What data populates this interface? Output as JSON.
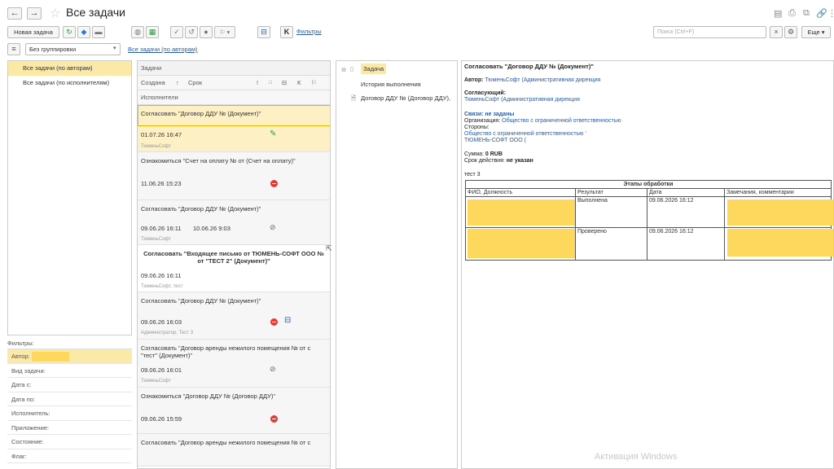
{
  "window": {
    "title": "Все задачи"
  },
  "toolbar": {
    "new_task": "Новая задача",
    "filters_link": "Фильтры",
    "search_placeholder": "Поиск (Ctrl+F)",
    "more": "Еще"
  },
  "grouping": {
    "value": "Без группировки",
    "link": "Все задачи (по авторам)"
  },
  "left_nav": [
    "Все задачи (по авторам)",
    "Все задачи (по исполнителям)"
  ],
  "filters": {
    "label": "Фильтры:",
    "items": [
      "Автор:",
      "Вид задачи:",
      "Дата с:",
      "Дата по:",
      "Исполнитель:",
      "Приложение:",
      "Состояние:",
      "Флаг:"
    ]
  },
  "task_list": {
    "header": "Задачи",
    "col_created": "Создана",
    "col_due": "Срок",
    "col_executors": "Исполнители",
    "col_k": "К",
    "tasks": [
      {
        "title": "Согласовать \"Договор ДДУ № (Документ)\"",
        "date": "01.07.26 16:47",
        "date2": "",
        "sub": "ТюменьСофт"
      },
      {
        "title": "Ознакомиться \"Счет на оплату № от (Счет на оплату)\"",
        "date": "11.06.26 15:23",
        "date2": "",
        "sub": ""
      },
      {
        "title": "Согласовать \"Договор ДДУ № (Документ)\"",
        "date": "09.06.26 16:11",
        "date2": "10.06.26 9:03",
        "sub": "ТюменьСофт"
      },
      {
        "title": "Согласовать \"Входящее письмо от ТЮМЕНЬ-СОФТ ООО № от \"ТЕСТ 2\" (Документ)\"",
        "date": "09.06.26 16:11",
        "date2": "",
        "sub": "ТюменьСофт, тест"
      },
      {
        "title": "Согласовать \"Договор ДДУ № (Документ)\"",
        "date": "09.06.26 16:03",
        "date2": "",
        "sub": "Администратор, Тест 3"
      },
      {
        "title": "Согласовать \"Договор аренды нежилого помещения № от с \"тест\" (Документ)\"",
        "date": "09.06.26 16:01",
        "date2": "",
        "sub": "ТюменьСофт"
      },
      {
        "title": "Ознакомиться \"Договор ДДУ № (Договор ДДУ)\"",
        "date": "09.06.26 15:59",
        "date2": "",
        "sub": ""
      },
      {
        "title": "Согласовать \"Договор аренды нежилого помещения № от с",
        "date": "",
        "date2": "",
        "sub": ""
      }
    ]
  },
  "tree": {
    "task": "Задача",
    "history": "История выполнения",
    "document": "Договор ДДУ № (Договор ДДУ),"
  },
  "doc": {
    "heading": "Согласовать \"Договор ДДУ № (Документ)\"",
    "author_label": "Автор:",
    "author_value": "ТюменьСофт (Административная дирекция",
    "approver_label": "Согласующий:",
    "approver_value": "ТюменьСофт (Административная дирекция",
    "links_label": "Связи: не заданы",
    "org_label": "Организация:",
    "org_value": "Общество с ограниченной ответственностью",
    "parties_label": "Стороны:",
    "parties_value1": "Общество с ограниченной ответственностью '",
    "parties_value2": "ТЮМЕНЬ-СОФТ ООО (",
    "sum_label": "Сумма:",
    "sum_value": "0 RUB",
    "term_label": "Срок действия:",
    "term_value": "не указан",
    "note": "тест 3",
    "stages_title": "Этапы обработки",
    "cols": [
      "ФИО, Должность",
      "Результат",
      "Дата",
      "Замечания, комментарии"
    ],
    "rows": [
      {
        "result": "Выполнена",
        "date": "09.06.2026 16:12"
      },
      {
        "result": "Проверено",
        "date": "09.06.2026 16:12"
      }
    ]
  },
  "watermark": "Активация Windows"
}
